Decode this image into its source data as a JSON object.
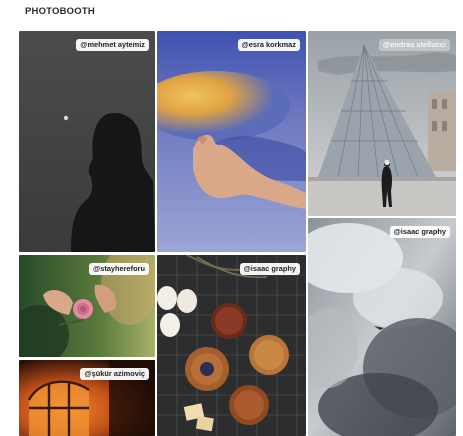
{
  "section": {
    "title": "PHOTOBOOTH"
  },
  "photos": [
    {
      "credit": "@mehmet aytemiz",
      "subject": "silhouette-at-dusk"
    },
    {
      "credit": "@esra korkmaz",
      "subject": "hand-shadow"
    },
    {
      "credit": "@endras stellucci",
      "subject": "louvre-pyramid"
    },
    {
      "credit": "@isaac graphy",
      "subject": "cloudy-sky-plane"
    },
    {
      "credit": "@stayhereforu",
      "subject": "hands-holding-rose"
    },
    {
      "credit": "@isaac graphy",
      "subject": "pastries-and-eggs"
    },
    {
      "credit": "@şükür azimoviç",
      "subject": "orange-window-light"
    }
  ],
  "colors": {
    "title": "#2b2b2b",
    "credit_bg": "#ffffff",
    "credit_text": "#222222"
  }
}
